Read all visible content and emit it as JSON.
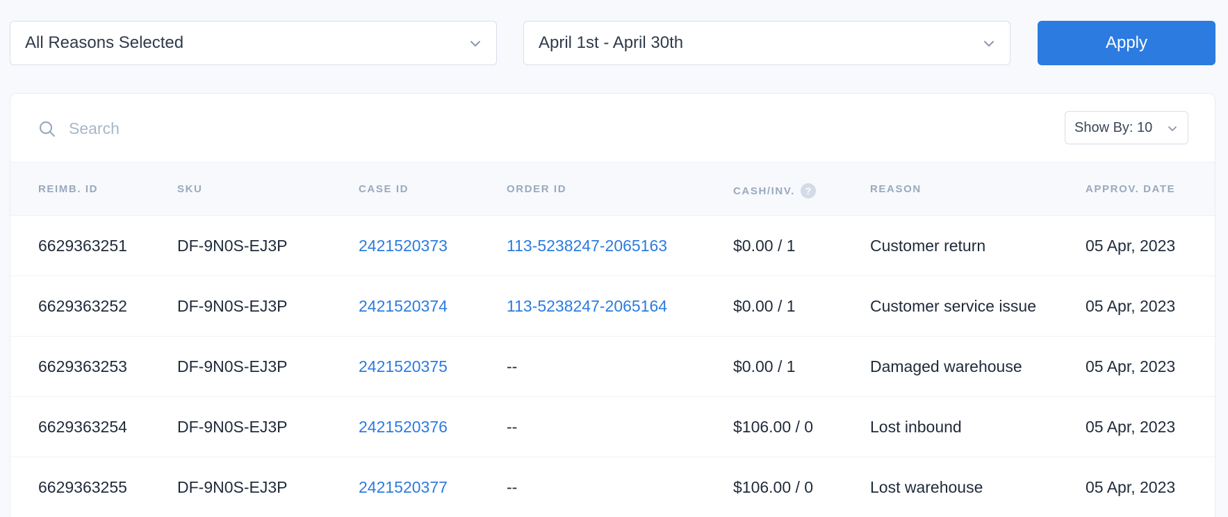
{
  "filters": {
    "reason_value": "All Reasons Selected",
    "date_value": "April 1st - April 30th",
    "apply_label": "Apply"
  },
  "search": {
    "placeholder": "Search"
  },
  "show_by": {
    "label": "Show By: 10"
  },
  "columns": [
    "REIMB. ID",
    "SKU",
    "CASE ID",
    "ORDER ID",
    "CASH/INV.",
    "REASON",
    "APPROV. DATE"
  ],
  "help_glyph": "?",
  "rows": [
    {
      "reimb_id": "6629363251",
      "sku": "DF-9N0S-EJ3P",
      "case_id": "2421520373",
      "order_id": "113-5238247-2065163",
      "cash_inv": "$0.00 / 1",
      "reason": "Customer return",
      "date": "05 Apr, 2023"
    },
    {
      "reimb_id": "6629363252",
      "sku": "DF-9N0S-EJ3P",
      "case_id": "2421520374",
      "order_id": "113-5238247-2065164",
      "cash_inv": "$0.00 / 1",
      "reason": "Customer service issue",
      "date": "05 Apr, 2023"
    },
    {
      "reimb_id": "6629363253",
      "sku": "DF-9N0S-EJ3P",
      "case_id": "2421520375",
      "order_id": "--",
      "cash_inv": "$0.00 / 1",
      "reason": "Damaged warehouse",
      "date": "05 Apr, 2023"
    },
    {
      "reimb_id": "6629363254",
      "sku": "DF-9N0S-EJ3P",
      "case_id": "2421520376",
      "order_id": "--",
      "cash_inv": "$106.00 / 0",
      "reason": "Lost inbound",
      "date": "05 Apr, 2023"
    },
    {
      "reimb_id": "6629363255",
      "sku": "DF-9N0S-EJ3P",
      "case_id": "2421520377",
      "order_id": "--",
      "cash_inv": "$106.00 / 0",
      "reason": "Lost warehouse",
      "date": "05 Apr, 2023"
    }
  ],
  "icons": {
    "search": "search-icon",
    "chevron": "chevron-down-icon",
    "help": "help-icon"
  },
  "colors": {
    "accent": "#2b7be0",
    "background": "#f7f9fc",
    "muted": "#9aa9bd"
  }
}
